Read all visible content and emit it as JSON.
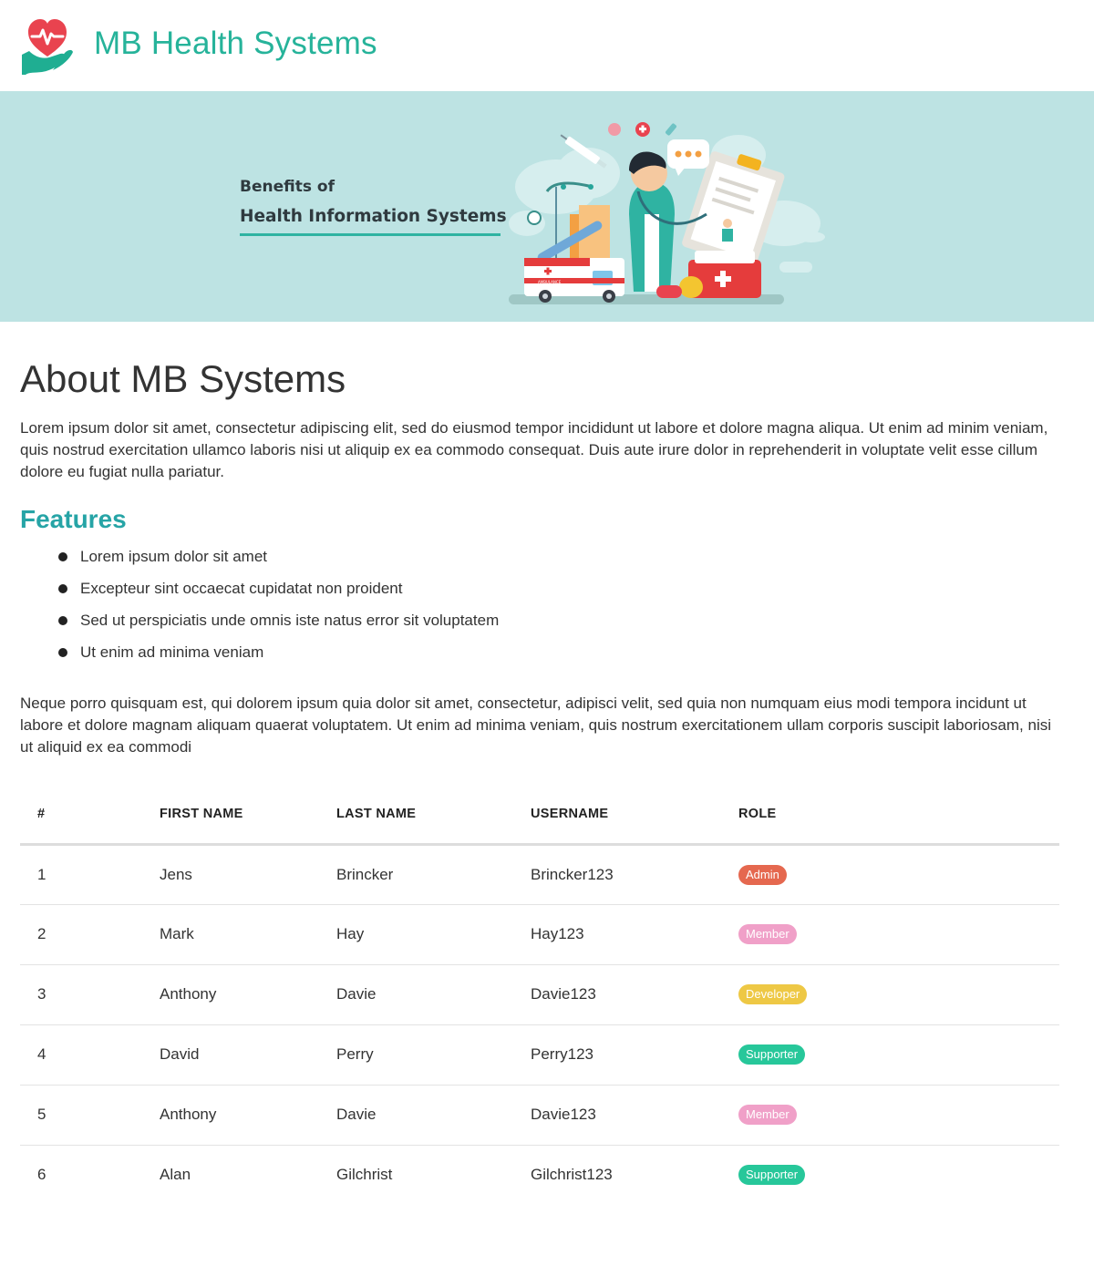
{
  "header": {
    "brand": "MB Health Systems",
    "logo_icon": "heart-hand-icon"
  },
  "banner": {
    "line1": "Benefits of",
    "line2": "Health Information Systems",
    "ambulance_label": "AMBULANCE",
    "illustration": "medical-illustration"
  },
  "about": {
    "title": "About MB Systems",
    "text": "Lorem ipsum dolor sit amet, consectetur adipiscing elit, sed do eiusmod tempor incididunt ut labore et dolore magna aliqua. Ut enim ad minim veniam, quis nostrud exercitation ullamco laboris nisi ut aliquip ex ea commodo consequat. Duis aute irure dolor in reprehenderit in voluptate velit esse cillum dolore eu fugiat nulla pariatur."
  },
  "features": {
    "title": "Features",
    "items": [
      "Lorem ipsum dolor sit amet",
      "Excepteur sint occaecat cupidatat non proident",
      "Sed ut perspiciatis unde omnis iste natus error sit voluptatem",
      "Ut enim ad minima veniam"
    ]
  },
  "neque": {
    "text": "Neque porro quisquam est, qui dolorem ipsum quia dolor sit amet, consectetur, adipisci velit, sed quia non numquam eius modi tempora in­cidunt ut labore et dolore magnam aliquam quaerat voluptatem. Ut enim ad minima veniam, quis nostrum exercitationem ullam corporis sus­cipit laboriosam, nisi ut aliquid ex ea commodi"
  },
  "table": {
    "headers": {
      "num": "#",
      "first": "FIRST NAME",
      "last": "LAST NAME",
      "user": "USERNAME",
      "role": "ROLE"
    },
    "rows": [
      {
        "num": "1",
        "first": "Jens",
        "last": "Brincker",
        "user": "Brincker123",
        "role": "Admin",
        "color": "#e5684f"
      },
      {
        "num": "2",
        "first": "Mark",
        "last": "Hay",
        "user": "Hay123",
        "role": "Member",
        "color": "#f0a0c8"
      },
      {
        "num": "3",
        "first": "Anthony",
        "last": "Davie",
        "user": "Davie123",
        "role": "Developer",
        "color": "#eec845"
      },
      {
        "num": "4",
        "first": "David",
        "last": "Perry",
        "user": "Perry123",
        "role": "Supporter",
        "color": "#27c79a"
      },
      {
        "num": "5",
        "first": "Anthony",
        "last": "Davie",
        "user": "Davie123",
        "role": "Member",
        "color": "#f0a0c8"
      },
      {
        "num": "6",
        "first": "Alan",
        "last": "Gilchrist",
        "user": "Gilchrist123",
        "role": "Supporter",
        "color": "#27c79a"
      }
    ]
  }
}
